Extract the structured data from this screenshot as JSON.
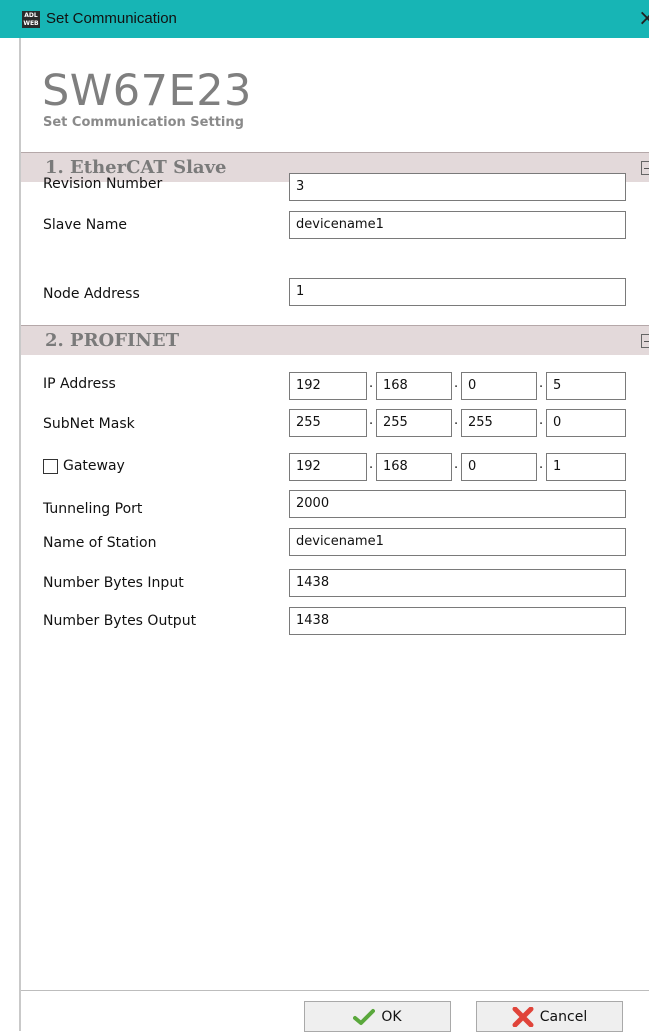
{
  "window": {
    "title": "Set Communication",
    "app_icon_text_line1": "ADL",
    "app_icon_text_line2": "WEB",
    "close_glyph": "×"
  },
  "header": {
    "title": "SW67E23",
    "subtitle": "Set Communication Setting"
  },
  "section1": {
    "title": "1. EtherCAT Slave",
    "fields": {
      "revision_number": {
        "label": "Revision Number",
        "value": "3"
      },
      "slave_name": {
        "label": "Slave Name",
        "value": "devicename1"
      },
      "node_address": {
        "label": "Node Address",
        "value": "1"
      }
    }
  },
  "section2": {
    "title": "2. PROFINET",
    "ip_address": {
      "label": "IP Address",
      "octets": [
        "192",
        "168",
        "0",
        "5"
      ]
    },
    "subnet_mask": {
      "label": "SubNet Mask",
      "octets": [
        "255",
        "255",
        "255",
        "0"
      ]
    },
    "gateway": {
      "label": "Gateway",
      "checked": false,
      "octets": [
        "192",
        "168",
        "0",
        "1"
      ]
    },
    "tunneling_port": {
      "label": "Tunneling Port",
      "value": "2000"
    },
    "name_of_station": {
      "label": "Name of Station",
      "value": "devicename1"
    },
    "number_bytes_input": {
      "label": "Number Bytes Input",
      "value": "1438"
    },
    "number_bytes_output": {
      "label": "Number Bytes Output",
      "value": "1438"
    }
  },
  "buttons": {
    "ok_label": "OK",
    "cancel_label": "Cancel"
  },
  "colors": {
    "titlebar": "#17b5b5",
    "section_header": "#e3d9da",
    "ok_icon": "#5aa83c",
    "cancel_icon": "#e0443a"
  }
}
